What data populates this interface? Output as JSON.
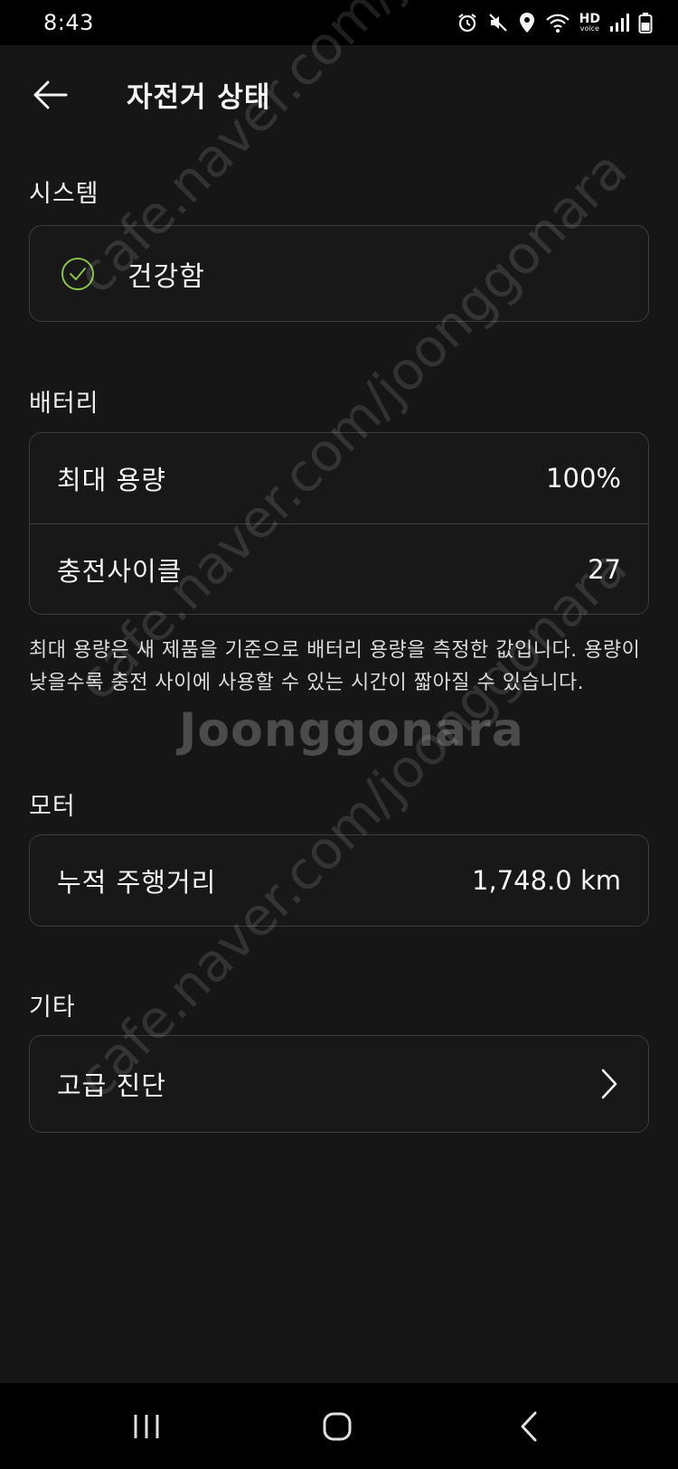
{
  "status_bar": {
    "time": "8:43",
    "hd_label": "HD",
    "voice_label": "voice"
  },
  "header": {
    "title": "자전거 상태"
  },
  "system": {
    "section_label": "시스템",
    "status": "건강함",
    "status_color": "#8bc34a"
  },
  "battery": {
    "section_label": "배터리",
    "rows": [
      {
        "label": "최대 용량",
        "value": "100%"
      },
      {
        "label": "충전사이클",
        "value": "27"
      }
    ],
    "note": "최대 용량은 새 제품을 기준으로 배터리 용량을 측정한 값입니다. 용량이 낮을수록 충전 사이에 사용할 수 있는 시간이 짧아질 수 있습니다."
  },
  "motor": {
    "section_label": "모터",
    "rows": [
      {
        "label": "누적 주행거리",
        "value": "1,748.0 km"
      }
    ]
  },
  "other": {
    "section_label": "기타",
    "rows": [
      {
        "label": "고급 진단"
      }
    ]
  },
  "watermark": {
    "brand": "Joonggonara",
    "url": "cafe.naver.com/joonggonara"
  }
}
